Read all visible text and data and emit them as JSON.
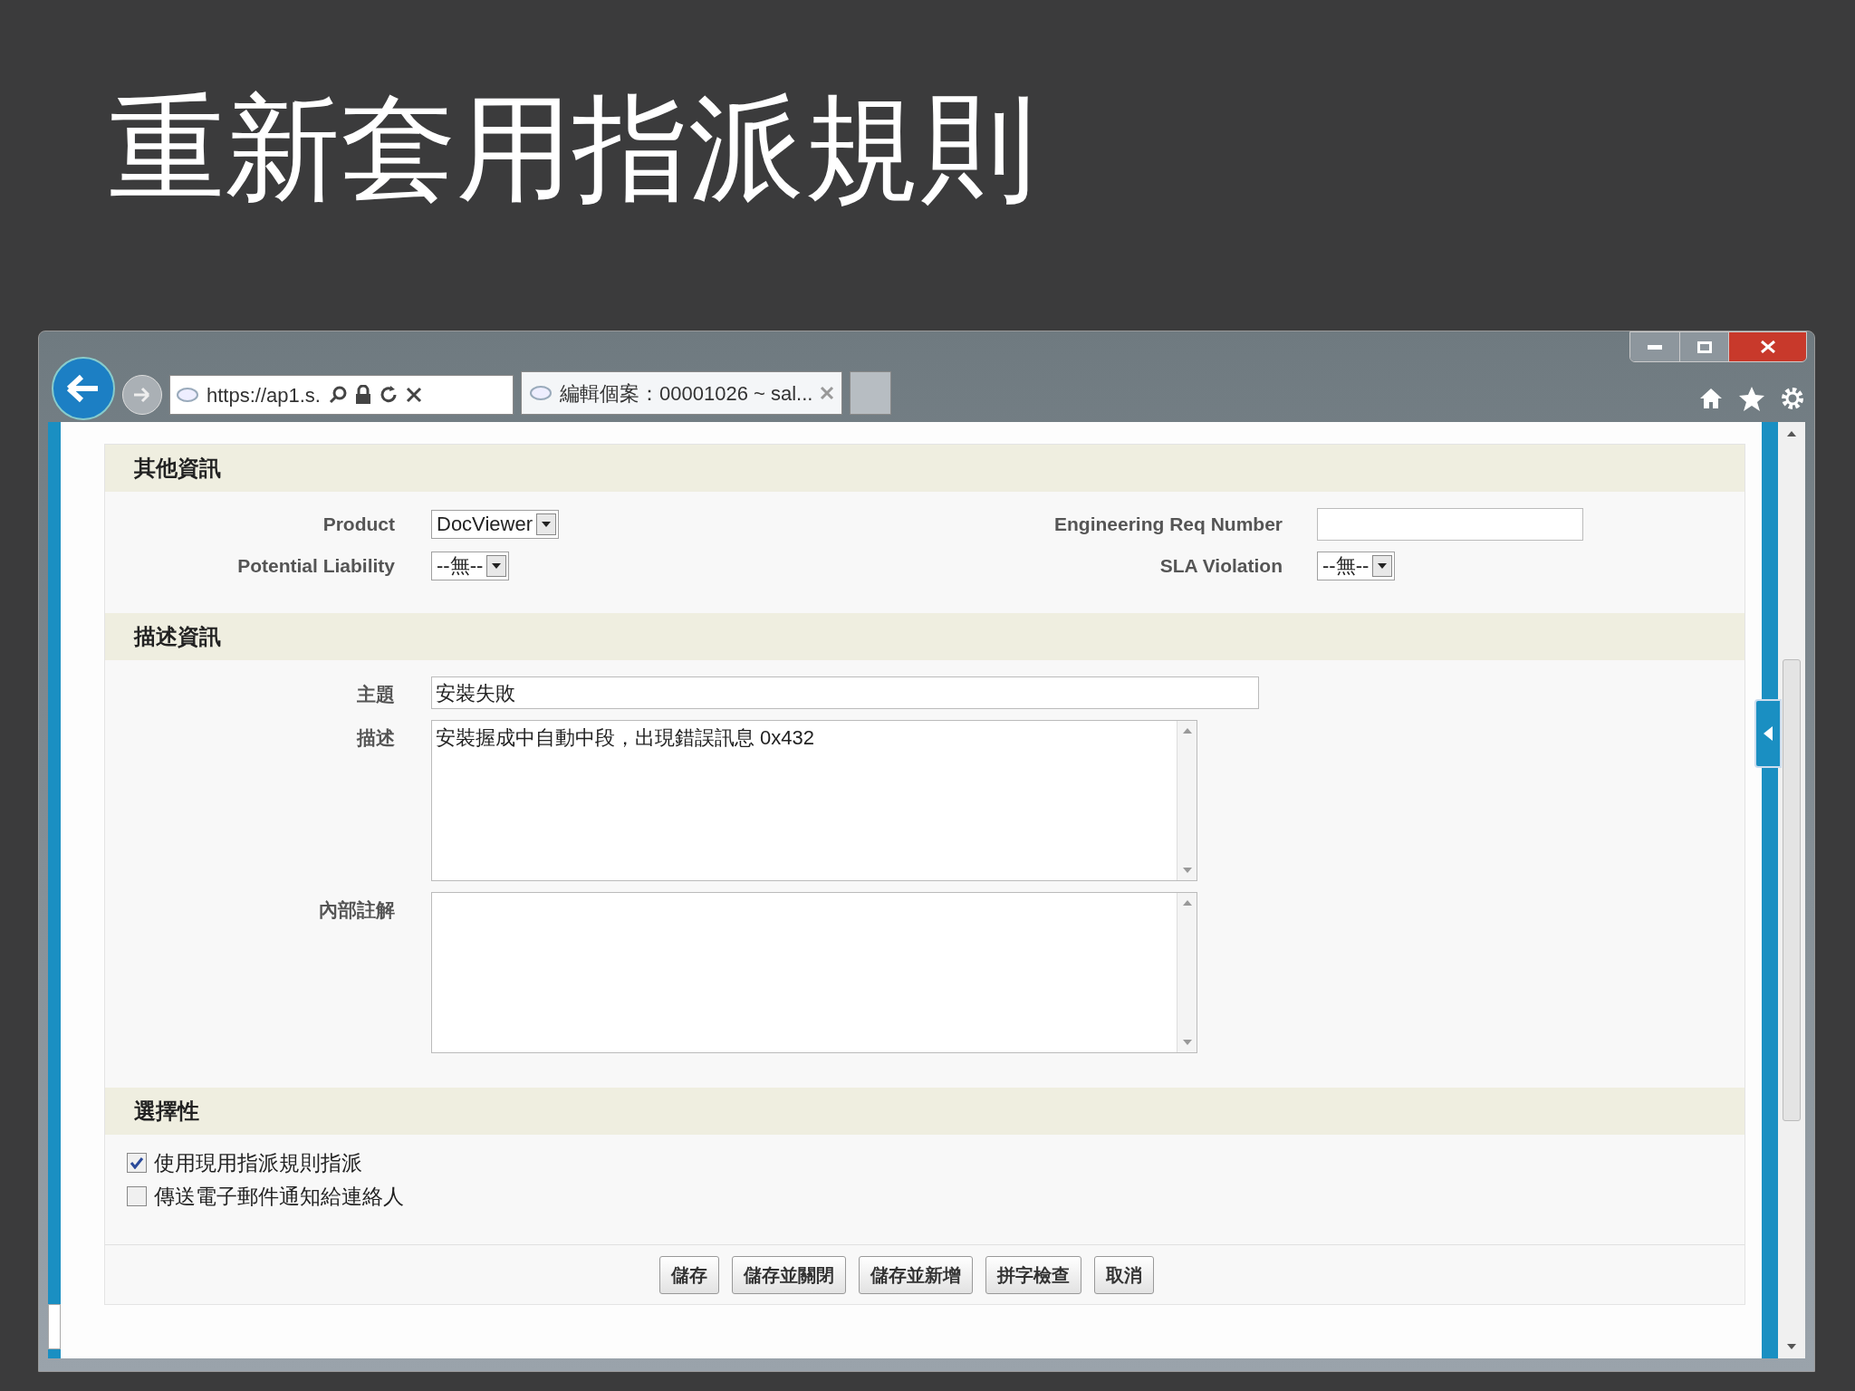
{
  "slide_title": "重新套用指派規則",
  "browser": {
    "address": "https://ap1.s.",
    "tabs": [
      {
        "label": "編輯個案：00001026 ~ sal...",
        "selected": true
      }
    ]
  },
  "other_info": {
    "title": "其他資訊",
    "rows": [
      {
        "left": {
          "label": "Product",
          "kind": "select",
          "value": "DocViewer"
        },
        "right": {
          "label": "Engineering Req Number",
          "kind": "text"
        }
      },
      {
        "left": {
          "label": "Potential Liability",
          "kind": "select",
          "value": "--無--"
        },
        "right": {
          "label": "SLA Violation",
          "kind": "select",
          "value": "--無--"
        }
      }
    ]
  },
  "description_info": {
    "title": "描述資訊",
    "fields": [
      {
        "label": "主題",
        "kind": "text",
        "value": "安裝失敗"
      },
      {
        "label": "描述",
        "kind": "textarea",
        "value": "安裝握成中自動中段，出現錯誤訊息 0x432"
      },
      {
        "label": "內部註解",
        "kind": "textarea"
      }
    ]
  },
  "optional": {
    "title": "選擇性",
    "options": [
      {
        "label": "使用現用指派規則指派",
        "checked": true
      },
      {
        "label": "傳送電子郵件通知給連絡人",
        "checked": false
      }
    ]
  },
  "buttons": [
    "儲存",
    "儲存並關閉",
    "儲存並新增",
    "拼字檢查",
    "取消"
  ]
}
